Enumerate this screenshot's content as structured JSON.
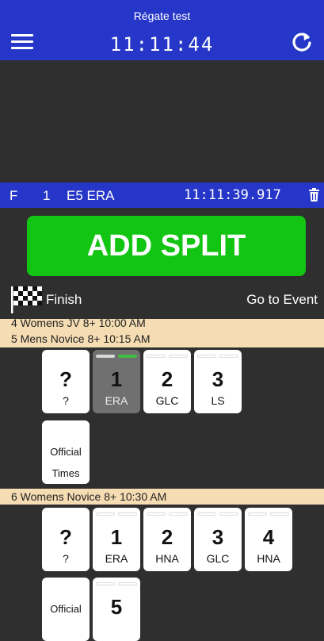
{
  "header": {
    "title": "Régate test",
    "clock": "11:11:44"
  },
  "split_bar": {
    "col1": "F",
    "col2": "1",
    "col3": "E5 ERA",
    "time": "11:11:39.917"
  },
  "add_split_label": "ADD SPLIT",
  "finish_label": "Finish",
  "go_to_event_label": "Go to Event",
  "events": [
    {
      "label": "4 Womens JV 8+ 10:00 AM"
    },
    {
      "label": "5 Mens Novice 8+ 10:15 AM",
      "cards": [
        {
          "num": "?",
          "crew": "?"
        },
        {
          "num": "1",
          "crew": "ERA"
        },
        {
          "num": "2",
          "crew": "GLC"
        },
        {
          "num": "3",
          "crew": "LS"
        }
      ],
      "official": {
        "line1": "Official",
        "line2": "Times"
      }
    },
    {
      "label": "6 Womens Novice 8+ 10:30 AM",
      "cards": [
        {
          "num": "?",
          "crew": "?"
        },
        {
          "num": "1",
          "crew": "ERA"
        },
        {
          "num": "2",
          "crew": "HNA"
        },
        {
          "num": "3",
          "crew": "GLC"
        },
        {
          "num": "4",
          "crew": "HNA"
        },
        {
          "num": "5",
          "crew": ""
        }
      ],
      "official": {
        "line1": "Official"
      }
    }
  ],
  "colors": {
    "header_blue": "#2536c8",
    "add_green": "#13c513",
    "event_band": "#f5dcb3",
    "selected_card": "#707070",
    "pill_green": "#3fbf3f"
  }
}
